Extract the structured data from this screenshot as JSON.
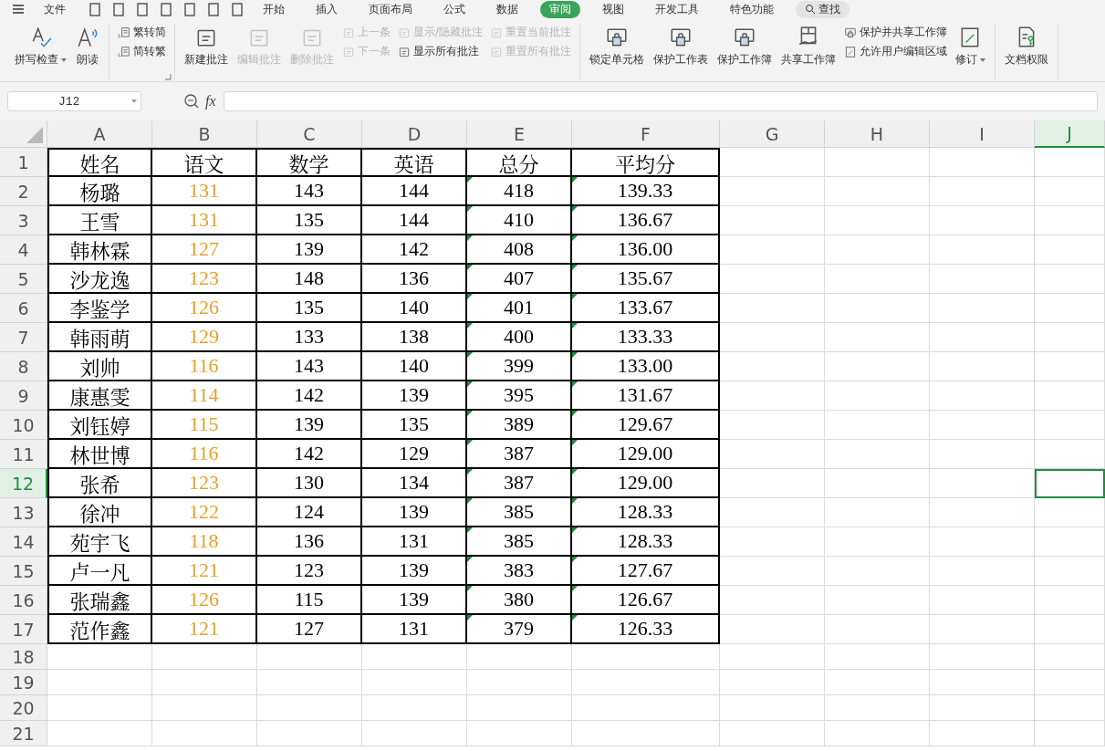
{
  "menu": [
    {
      "label": "文件",
      "selected": false
    },
    {
      "label": "开始",
      "selected": false
    },
    {
      "label": "插入",
      "selected": false
    },
    {
      "label": "页面布局",
      "selected": false
    },
    {
      "label": "公式",
      "selected": false
    },
    {
      "label": "数据",
      "selected": false
    },
    {
      "label": "审阅",
      "selected": true
    },
    {
      "label": "视图",
      "selected": false
    },
    {
      "label": "开发工具",
      "selected": false
    },
    {
      "label": "特色功能",
      "selected": false
    }
  ],
  "search": {
    "label": "查找"
  },
  "toolbar": [
    {
      "items": [
        {
          "kind": "large",
          "label": "拼写检查",
          "dropdown": true,
          "disabled": false
        },
        {
          "kind": "large",
          "label": "朗读",
          "dropdown": false,
          "disabled": false
        }
      ]
    },
    {
      "launcher": true,
      "items": [
        {
          "kind": "stack",
          "items": [
            {
              "label": "繁转简",
              "disabled": false
            },
            {
              "label": "简转繁",
              "disabled": false
            }
          ]
        }
      ]
    },
    {
      "items": [
        {
          "kind": "large",
          "label": "新建批注",
          "dropdown": false,
          "disabled": false
        },
        {
          "kind": "large",
          "label": "编辑批注",
          "dropdown": false,
          "disabled": true
        },
        {
          "kind": "large",
          "label": "删除批注",
          "dropdown": false,
          "disabled": true
        },
        {
          "kind": "stack",
          "items": [
            {
              "label": "上一条",
              "disabled": true
            },
            {
              "label": "下一条",
              "disabled": true
            }
          ]
        },
        {
          "kind": "stack",
          "items": [
            {
              "label": "显示/隐藏批注",
              "disabled": true
            },
            {
              "label": "显示所有批注",
              "disabled": false
            }
          ]
        },
        {
          "kind": "stack",
          "items": [
            {
              "label": "重置当前批注",
              "disabled": true
            },
            {
              "label": "重置所有批注",
              "disabled": true
            }
          ]
        }
      ]
    },
    {
      "items": [
        {
          "kind": "large",
          "label": "锁定单元格",
          "dropdown": false,
          "disabled": false
        },
        {
          "kind": "large",
          "label": "保护工作表",
          "dropdown": false,
          "disabled": false
        },
        {
          "kind": "large",
          "label": "保护工作簿",
          "dropdown": false,
          "disabled": false
        },
        {
          "kind": "large",
          "label": "共享工作簿",
          "dropdown": false,
          "disabled": false
        },
        {
          "kind": "stack",
          "items": [
            {
              "label": "保护并共享工作簿",
              "disabled": false
            },
            {
              "label": "允许用户编辑区域",
              "disabled": false
            }
          ]
        },
        {
          "kind": "large",
          "label": "修订",
          "dropdown": true,
          "disabled": false
        }
      ]
    },
    {
      "items": [
        {
          "kind": "large",
          "label": "文档权限",
          "dropdown": false,
          "disabled": false
        }
      ]
    }
  ],
  "name_box": {
    "value": "J12"
  },
  "formula_bar": {
    "fx": "fx"
  },
  "columns": [
    {
      "label": "A",
      "selected": false,
      "flagged": false
    },
    {
      "label": "B",
      "selected": false,
      "flagged": false,
      "color": "#e8a02c"
    },
    {
      "label": "C",
      "selected": false,
      "flagged": false
    },
    {
      "label": "D",
      "selected": false,
      "flagged": false
    },
    {
      "label": "E",
      "selected": false,
      "flagged": true
    },
    {
      "label": "F",
      "selected": false,
      "flagged": true
    },
    {
      "label": "G",
      "selected": false,
      "flagged": false
    },
    {
      "label": "H",
      "selected": false,
      "flagged": false
    },
    {
      "label": "I",
      "selected": false,
      "flagged": false
    },
    {
      "label": "J",
      "selected": true,
      "flagged": false
    }
  ],
  "rows": [
    {
      "header": "1",
      "selected": false,
      "kind": "heading",
      "cells": [
        "姓名",
        "语文",
        "数学",
        "英语",
        "总分",
        "平均分"
      ]
    },
    {
      "header": "2",
      "selected": false,
      "kind": "data",
      "cells": [
        "杨璐",
        "131",
        "143",
        "144",
        "418",
        "139.33"
      ]
    },
    {
      "header": "3",
      "selected": false,
      "kind": "data",
      "cells": [
        "王雪",
        "131",
        "135",
        "144",
        "410",
        "136.67"
      ]
    },
    {
      "header": "4",
      "selected": false,
      "kind": "data",
      "cells": [
        "韩林霖",
        "127",
        "139",
        "142",
        "408",
        "136.00"
      ]
    },
    {
      "header": "5",
      "selected": false,
      "kind": "data",
      "cells": [
        "沙龙逸",
        "123",
        "148",
        "136",
        "407",
        "135.67"
      ]
    },
    {
      "header": "6",
      "selected": false,
      "kind": "data",
      "cells": [
        "李鉴学",
        "126",
        "135",
        "140",
        "401",
        "133.67"
      ]
    },
    {
      "header": "7",
      "selected": false,
      "kind": "data",
      "cells": [
        "韩雨萌",
        "129",
        "133",
        "138",
        "400",
        "133.33"
      ]
    },
    {
      "header": "8",
      "selected": false,
      "kind": "data",
      "cells": [
        "刘帅",
        "116",
        "143",
        "140",
        "399",
        "133.00"
      ]
    },
    {
      "header": "9",
      "selected": false,
      "kind": "data",
      "cells": [
        "康惠雯",
        "114",
        "142",
        "139",
        "395",
        "131.67"
      ]
    },
    {
      "header": "10",
      "selected": false,
      "kind": "data",
      "cells": [
        "刘钰婷",
        "115",
        "139",
        "135",
        "389",
        "129.67"
      ]
    },
    {
      "header": "11",
      "selected": false,
      "kind": "data",
      "cells": [
        "林世博",
        "116",
        "142",
        "129",
        "387",
        "129.00"
      ]
    },
    {
      "header": "12",
      "selected": true,
      "kind": "data",
      "cells": [
        "张希",
        "123",
        "130",
        "134",
        "387",
        "129.00"
      ]
    },
    {
      "header": "13",
      "selected": false,
      "kind": "data",
      "cells": [
        "徐冲",
        "122",
        "124",
        "139",
        "385",
        "128.33"
      ]
    },
    {
      "header": "14",
      "selected": false,
      "kind": "data",
      "cells": [
        "苑宇飞",
        "118",
        "136",
        "131",
        "385",
        "128.33"
      ]
    },
    {
      "header": "15",
      "selected": false,
      "kind": "data",
      "cells": [
        "卢一凡",
        "121",
        "123",
        "139",
        "383",
        "127.67"
      ]
    },
    {
      "header": "16",
      "selected": false,
      "kind": "data",
      "cells": [
        "张瑞鑫",
        "126",
        "115",
        "139",
        "380",
        "126.67"
      ]
    },
    {
      "header": "17",
      "selected": false,
      "kind": "data",
      "cells": [
        "范作鑫",
        "121",
        "127",
        "131",
        "379",
        "126.33"
      ]
    },
    {
      "header": "18",
      "selected": false,
      "kind": "empty"
    },
    {
      "header": "19",
      "selected": false,
      "kind": "empty"
    },
    {
      "header": "20",
      "selected": false,
      "kind": "empty"
    },
    {
      "header": "21",
      "selected": false,
      "kind": "empty"
    }
  ]
}
